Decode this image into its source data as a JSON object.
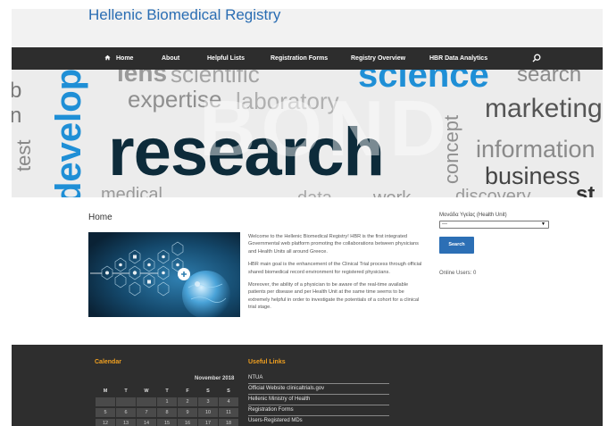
{
  "header": {
    "title": "Hellenic Biomedical Registry"
  },
  "nav": {
    "items": [
      {
        "label": "Home",
        "name": "nav-home"
      },
      {
        "label": "About",
        "name": "nav-about"
      },
      {
        "label": "Helpful Lists",
        "name": "nav-helpful-lists"
      },
      {
        "label": "Registration Forms",
        "name": "nav-registration-forms"
      },
      {
        "label": "Registry Overview",
        "name": "nav-registry-overview"
      },
      {
        "label": "HBR Data Analytics",
        "name": "nav-hbr-data-analytics"
      }
    ],
    "home_icon": "home-icon",
    "search_icon": "search-icon"
  },
  "banner": {
    "words": [
      "lens",
      "scientific",
      "science",
      "search",
      "expertise",
      "laboratory",
      "marketing",
      "research",
      "information",
      "business",
      "concept",
      "develop",
      "test",
      "BOND",
      "medical",
      "data",
      "work",
      "discovery",
      "st",
      "b",
      "n"
    ]
  },
  "main": {
    "heading": "Home",
    "paragraphs": [
      "Welcome to the Hellenic Biomedical Registry! HBR is the first integrated Governmental web platform promoting the collaborations between physicians and Health Units all around Greece.",
      "HBR main goal is the enhancement of the Clinical Trial process through official shared biomedical record environment for registered physicians.",
      "Moreover, the ability of a physician to be aware of the real-time available patients per disease and per Health Unit at the same time seems to be extremely helpful in order to investigate the potentials of a cohort for a clinical trial stage."
    ]
  },
  "sidebar": {
    "unit_label": "Μονάδα Υγείας (Health Unit)",
    "unit_selected": "---",
    "search_label": "Search",
    "online_users": "Online Users: 0"
  },
  "footer": {
    "calendar_title": "Calendar",
    "month": "November 2018",
    "weekdays": [
      "M",
      "T",
      "W",
      "T",
      "F",
      "S",
      "S"
    ],
    "rows": [
      [
        "",
        "",
        "",
        "1",
        "2",
        "3",
        "4"
      ],
      [
        "5",
        "6",
        "7",
        "8",
        "9",
        "10",
        "11"
      ],
      [
        "12",
        "13",
        "14",
        "15",
        "16",
        "17",
        "18"
      ]
    ],
    "links_title": "Useful Links",
    "links": [
      "NTUA",
      "Official Website clinicaltrials.gov",
      "Hellenic Ministry of Health",
      "Registration Forms",
      "Users-Registered MDs"
    ]
  },
  "colors": {
    "brand": "#2a6db3",
    "nav_bg": "#2d2d2d",
    "footer_bg": "#2e2e2e",
    "footer_heading": "#f0a020",
    "button": "#2c6fb5",
    "banner_blue": "#1f8fd6",
    "banner_dark": "#0d2b3a"
  }
}
